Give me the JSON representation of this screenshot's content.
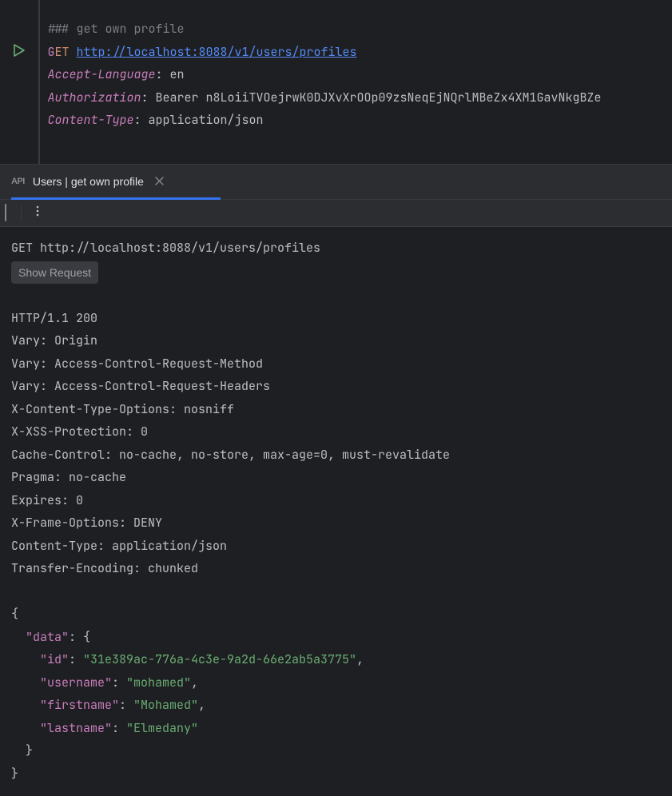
{
  "editor": {
    "section_comment_prefix": "### ",
    "section_comment_text": "get own profile",
    "method": "GET",
    "url": "http://localhost:8088/v1/users/profiles",
    "headers": [
      {
        "name": "Accept-Language",
        "value": "en"
      },
      {
        "name": "Authorization",
        "value": "Bearer n8LoiiTVOejrwK0DJXvXrOOp09zsNeqEjNQrlMBeZx4XM1GavNkgBZe"
      },
      {
        "name": "Content-Type",
        "value": "application/json"
      }
    ]
  },
  "tab": {
    "icon_label": "API",
    "title": "Users | get own profile"
  },
  "output": {
    "request_line": "GET http://localhost:8088/v1/users/profiles",
    "show_request_label": "Show Request",
    "status_line": "HTTP/1.1 200",
    "response_headers": [
      "Vary: Origin",
      "Vary: Access-Control-Request-Method",
      "Vary: Access-Control-Request-Headers",
      "X-Content-Type-Options: nosniff",
      "X-XSS-Protection: 0",
      "Cache-Control: no-cache, no-store, max-age=0, must-revalidate",
      "Pragma: no-cache",
      "Expires: 0",
      "X-Frame-Options: DENY",
      "Content-Type: application/json",
      "Transfer-Encoding: chunked"
    ],
    "json_body": {
      "l0_open": "{",
      "l1_key": "\"data\"",
      "l1_open": ": {",
      "kv": [
        {
          "k": "\"id\"",
          "v": "\"31e389ac-776a-4c3e-9a2d-66e2ab5a3775\"",
          "comma": ","
        },
        {
          "k": "\"username\"",
          "v": "\"mohamed\"",
          "comma": ","
        },
        {
          "k": "\"firstname\"",
          "v": "\"Mohamed\"",
          "comma": ","
        },
        {
          "k": "\"lastname\"",
          "v": "\"Elmedany\"",
          "comma": ""
        }
      ],
      "l1_close": "  }",
      "l0_close": "}"
    }
  }
}
